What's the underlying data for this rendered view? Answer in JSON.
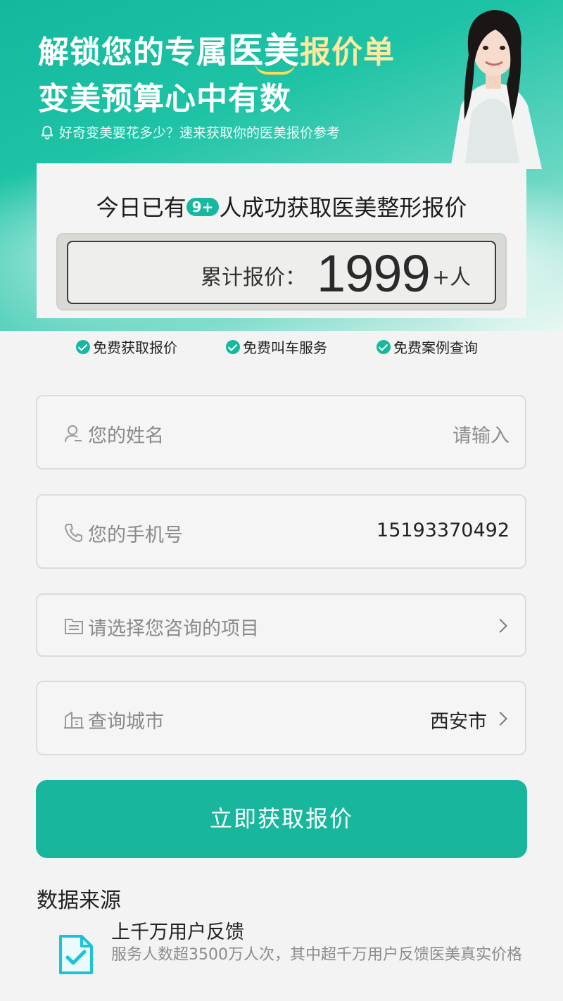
{
  "hero": {
    "line1_a": "解锁您的专属",
    "line1_b": "医美",
    "line1_c": "报价单",
    "line2": "变美预算心中有数",
    "tip": "好奇变美要花多少？速来获取你的医美报价参考"
  },
  "counter": {
    "today_prefix": "今日已有",
    "today_badge": "9+",
    "today_suffix": "人成功获取医美整形报价",
    "label": "累计报价：",
    "number": "1999",
    "unit": "+人"
  },
  "features": [
    {
      "label": "免费获取报价"
    },
    {
      "label": "免费叫车服务"
    },
    {
      "label": "免费案例查询"
    }
  ],
  "form": {
    "name": {
      "label": "您的姓名",
      "placeholder": "请输入"
    },
    "phone": {
      "label": "您的手机号",
      "value": "15193370492"
    },
    "project": {
      "label": "请选择您咨询的项目"
    },
    "city": {
      "label": "查询城市",
      "value": "西安市"
    }
  },
  "submit_label": "立即获取报价",
  "data_source": {
    "title": "数据来源",
    "item_title": "上千万用户反馈",
    "item_desc": "服务人数超3500万人次，其中超千万用户反馈医美真实价格"
  },
  "colors": {
    "accent": "#16b89e",
    "gold": "#ffe9a0"
  }
}
